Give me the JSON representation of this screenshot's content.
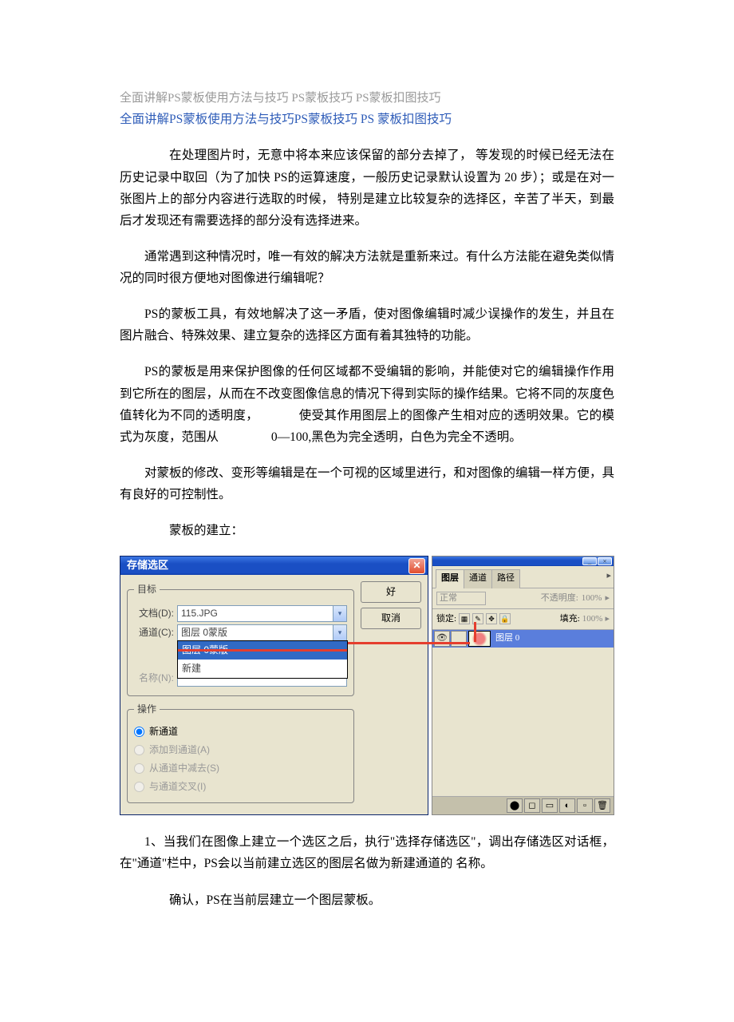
{
  "title_light": "全面讲解PS蒙板使用方法与技巧 PS蒙板技巧 PS蒙板扣图技巧",
  "title_main": "全面讲解PS蒙板使用方法与技巧PS蒙板技巧 PS 蒙板扣图技巧",
  "para1a": "在处理图片时，无意中将本来应该保留的部分去掉了，",
  "para1b": "等发现的时候已经无法在历史记录中取回（为了加快 PS的运算速度，一般历史记录默认设置为 20 步）；或是在对一张图片上的部分内容进行选取的时候，",
  "para1c": "特别是建立比较复杂的选择区，辛苦了半天，到最后才发现还有需要选择的部分没有选择进来。",
  "para2": "通常遇到这种情况时，唯一有效的解决方法就是重新来过。有什么方法能在避免类似情况的同时很方便地对图像进行编辑呢？",
  "para3": "PS的蒙板工具，有效地解决了这一矛盾，使对图像编辑时减少误操作的发生，并且在图片融合、特殊效果、建立复杂的选择区方面有着其独特的功能。",
  "para4a": "PS的蒙板是用来保护图像的任何区域都不受编辑的影响，并能使对它的编辑操作作用到它所在的图层，从而在不改变图像信息的情况下得到实际的操作结果。它将不同的灰度色值转化为不同的透明度，",
  "para4b": "使受其作用图层上的图像产生相对应的透明效果。它的模式为灰度，范围从",
  "para4c": "0—100,黑色为完全透明，白色为完全不透明。",
  "para5": "对蒙板的修改、变形等编辑是在一个可视的区域里进行，和对图像的编辑一样方便，具有良好的可控制性。",
  "para6": "蒙板的建立：",
  "dialog": {
    "title": "存储选区",
    "ok": "好",
    "cancel": "取消",
    "group1": "目标",
    "doc_label": "文档(D):",
    "doc_value": "115.JPG",
    "chan_label": "通道(C):",
    "chan_value": "图层 0蒙版",
    "name_label": "名称(N):",
    "dd_sel": "图层 0蒙版",
    "dd_new": "新建",
    "group2": "操作",
    "radio1": "新通道",
    "radio2": "添加到通道(A)",
    "radio3": "从通道中减去(S)",
    "radio4": "与通道交叉(I)"
  },
  "panel": {
    "tab1": "图层",
    "tab2": "通道",
    "tab3": "路径",
    "mode": "正常",
    "opacity_label": "不透明度:",
    "opacity_val": "100%",
    "lock_label": "锁定:",
    "fill_label": "填充:",
    "fill_val": "100%",
    "layer_name": "图层 0"
  },
  "para7": "1、当我们在图像上建立一个选区之后，执行\"选择存储选区\"，调出存储选区对话框，在\"通道\"栏中，PS会以当前建立选区的图层名做为新建通道的 名称。",
  "para8": "确认，PS在当前层建立一个图层蒙板。"
}
